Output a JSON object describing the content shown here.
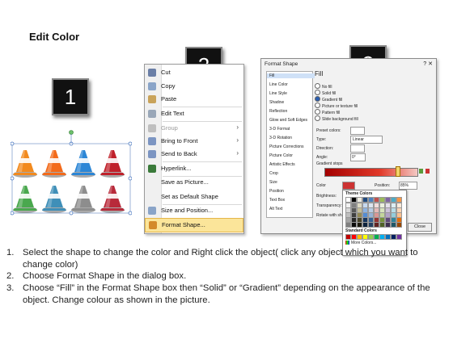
{
  "title": "Edit Color",
  "steps": [
    "1",
    "2",
    "3"
  ],
  "context_menu": {
    "items": [
      {
        "icon": "scissors-icon",
        "label": "Cut",
        "accel": "t",
        "state": "normal"
      },
      {
        "icon": "copy-icon",
        "label": "Copy",
        "accel": "C",
        "state": "normal"
      },
      {
        "icon": "paste-icon",
        "label": "Paste",
        "accel": "P",
        "state": "normal"
      },
      {
        "icon": "edit-text-icon",
        "label": "Edit Text",
        "accel": "x",
        "state": "normal"
      },
      {
        "icon": "group-icon",
        "label": "Group",
        "accel": "G",
        "state": "disabled",
        "submenu": true
      },
      {
        "icon": "bring-to-front-icon",
        "label": "Bring to Front",
        "accel": "r",
        "state": "normal",
        "submenu": true
      },
      {
        "icon": "send-to-back-icon",
        "label": "Send to Back",
        "accel": "k",
        "state": "normal",
        "submenu": true
      },
      {
        "icon": "hyperlink-icon",
        "label": "Hyperlink...",
        "accel": "H",
        "state": "normal"
      },
      {
        "icon": "",
        "label": "Save as Picture...",
        "accel": "S",
        "state": "normal"
      },
      {
        "icon": "",
        "label": "Set as Default Shape",
        "accel": "D",
        "state": "normal"
      },
      {
        "icon": "size-position-icon",
        "label": "Size and Position...",
        "accel": "z",
        "state": "normal"
      },
      {
        "icon": "format-shape-icon",
        "label": "Format Shape...",
        "accel": "o",
        "state": "highlighted"
      }
    ]
  },
  "format_dialog": {
    "title": "Format Shape",
    "window_buttons": "? ✕",
    "categories": [
      "Fill",
      "Line Color",
      "Line Style",
      "Shadow",
      "Reflection",
      "Glow and Soft Edges",
      "3-D Format",
      "3-D Rotation",
      "Picture Corrections",
      "Picture Color",
      "Artistic Effects",
      "Crop",
      "Size",
      "Position",
      "Text Box",
      "Alt Text"
    ],
    "selected_category": "Fill",
    "section_title": "Fill",
    "fill_options": [
      "No fill",
      "Solid fill",
      "Gradient fill",
      "Picture or texture fill",
      "Pattern fill",
      "Slide background fill"
    ],
    "selected_fill": "Gradient fill",
    "preset_colors_label": "Preset colors:",
    "type_label": "Type:",
    "type_value": "Linear",
    "direction_label": "Direction:",
    "angle_label": "Angle:",
    "angle_value": "0°",
    "gradient_stops_label": "Gradient stops",
    "color_label": "Color",
    "position_label": "Position:",
    "position_value": "85%",
    "brightness_label": "Brightness:",
    "transparency_label": "Transparency:",
    "rotate_label": "Rotate with shape",
    "theme_colors_label": "Theme Colors",
    "standard_colors_label": "Standard Colors",
    "more_colors_label": "More Colors...",
    "close_label": "Close"
  },
  "theme_colors": [
    [
      "#ffffff",
      "#000000",
      "#eeece1",
      "#1f497d",
      "#4f81bd",
      "#c0504d",
      "#9bbb59",
      "#8064a2",
      "#4bacc6",
      "#f79646"
    ],
    [
      "#f2f2f2",
      "#7f7f7f",
      "#ddd9c3",
      "#c6d9f0",
      "#dbe5f1",
      "#f2dcdb",
      "#ebf1dd",
      "#e5e0ec",
      "#dbeef3",
      "#fdeada"
    ],
    [
      "#d8d8d8",
      "#595959",
      "#c4bd97",
      "#8db3e2",
      "#b8cce4",
      "#e5b9b7",
      "#d7e3bc",
      "#ccc1d9",
      "#b7dde8",
      "#fbd5b5"
    ],
    [
      "#bfbfbf",
      "#3f3f3f",
      "#938953",
      "#548dd4",
      "#95b3d7",
      "#d99694",
      "#c3d69b",
      "#b2a2c7",
      "#92cddc",
      "#fac08f"
    ],
    [
      "#a5a5a5",
      "#262626",
      "#494429",
      "#17365d",
      "#366092",
      "#953734",
      "#76923c",
      "#5f497a",
      "#31859b",
      "#e36c09"
    ],
    [
      "#7f7f7f",
      "#0c0c0c",
      "#1d1b10",
      "#0f243e",
      "#244061",
      "#632423",
      "#4f6128",
      "#3f3151",
      "#205867",
      "#974806"
    ]
  ],
  "standard_colors": [
    "#c00000",
    "#ff0000",
    "#ffc000",
    "#ffff00",
    "#92d050",
    "#00b050",
    "#00b0f0",
    "#0070c0",
    "#002060",
    "#7030a0"
  ],
  "cones": [
    {
      "color": "#f28a1e",
      "band": "#ffffff"
    },
    {
      "color": "#f36a1a",
      "band": "#ffffff"
    },
    {
      "color": "#2b86d6",
      "band": "#ffffff"
    },
    {
      "color": "#c0202a",
      "band": "#ffffff"
    },
    {
      "color": "#4aa84e",
      "band": "#ffffff"
    },
    {
      "color": "#3f8fb8",
      "band": "#ffffff"
    },
    {
      "color": "#8d8d8d",
      "band": "#ffffff"
    },
    {
      "color": "#b82a3a",
      "band": "#ffffff"
    }
  ],
  "instructions": [
    {
      "num": "1.",
      "text": "Select the shape to change the color and Right click the object( click any object which you want to change color)"
    },
    {
      "num": "2.",
      "text": "Choose Format Shape in the dialog box."
    },
    {
      "num": "3.",
      "text": "Choose “Fill” in the Format Shape box then “Solid” or “Gradient” depending on the appearance of the object. Change colour as shown in the picture."
    }
  ]
}
